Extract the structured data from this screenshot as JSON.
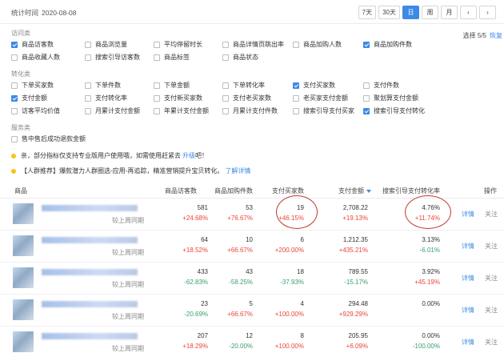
{
  "header": {
    "stat_label": "统计时间",
    "stat_date": "2020-08-08",
    "ranges": [
      "7天",
      "30天",
      "日",
      "周",
      "月"
    ],
    "active_range": "日",
    "prev_icon": "chevron-left-icon",
    "next_icon": "chevron-right-icon"
  },
  "selector": {
    "count_label": "选择 5/5",
    "reset_label": "恢复",
    "categories": {
      "visit": {
        "label": "访问类",
        "options": [
          {
            "label": "商品访客数",
            "checked": true
          },
          {
            "label": "商品浏览量",
            "checked": false
          },
          {
            "label": "平均停留时长",
            "checked": false
          },
          {
            "label": "商品详情页跳出率",
            "checked": false
          },
          {
            "label": "商品加购人数",
            "checked": false
          },
          {
            "label": "商品加购件数",
            "checked": true
          },
          {
            "label": "商品收藏人数",
            "checked": false
          },
          {
            "label": "搜索引导访客数",
            "checked": false
          },
          {
            "label": "商品标签",
            "checked": false
          },
          {
            "label": "商品状态",
            "checked": false
          }
        ]
      },
      "conversion": {
        "label": "转化类",
        "options": [
          {
            "label": "下单买家数",
            "checked": false
          },
          {
            "label": "下单件数",
            "checked": false
          },
          {
            "label": "下单金额",
            "checked": false
          },
          {
            "label": "下单转化率",
            "checked": false
          },
          {
            "label": "支付买家数",
            "checked": true
          },
          {
            "label": "支付件数",
            "checked": false
          },
          {
            "label": "支付金额",
            "checked": true
          },
          {
            "label": "支付转化率",
            "checked": false
          },
          {
            "label": "支付新买家数",
            "checked": false
          },
          {
            "label": "支付老买家数",
            "checked": false
          },
          {
            "label": "老买家支付金额",
            "checked": false
          },
          {
            "label": "聚划算支付金额",
            "checked": false
          },
          {
            "label": "访客平均价值",
            "checked": false
          },
          {
            "label": "月累计支付金额",
            "checked": false
          },
          {
            "label": "年累计支付金额",
            "checked": false
          },
          {
            "label": "月累计支付件数",
            "checked": false
          },
          {
            "label": "搜索引导支付买家",
            "checked": false
          },
          {
            "label": "搜索引导支付转化",
            "checked": true
          }
        ]
      },
      "service": {
        "label": "服务类",
        "options": [
          {
            "label": "售中售后成功退款金额",
            "checked": false
          }
        ]
      }
    }
  },
  "notices": [
    {
      "text": "亲，部分指标仅支持专业版用户使用哦，如需使用赶紧去",
      "link": "升级",
      "suffix": "吧！"
    },
    {
      "text": "【人群推荐】爆款潜力人群圈选-应用-再追踪，精准营销提升宝贝转化。",
      "link": "了解详情",
      "suffix": ""
    }
  ],
  "table": {
    "columns": {
      "product": "商品",
      "visitors": "商品访客数",
      "addcart": "商品加购件数",
      "buyers": "支付买家数",
      "amount": "支付金额",
      "search_conv": "搜索引导支付转化率",
      "actions": "操作"
    },
    "compare_label": "较上周同期",
    "detail_label": "详情",
    "follow_label": "关注",
    "rows": [
      {
        "visitors": "581",
        "visitors_chg": "+24.68%",
        "visitors_dir": "up",
        "addcart": "53",
        "addcart_chg": "+76.67%",
        "addcart_dir": "up",
        "buyers": "19",
        "buyers_chg": "+46.15%",
        "buyers_dir": "up",
        "amount": "2,708.22",
        "amount_chg": "+19.13%",
        "amount_dir": "up",
        "conv": "4.76%",
        "conv_chg": "+11.74%",
        "conv_dir": "up"
      },
      {
        "visitors": "64",
        "visitors_chg": "+18.52%",
        "visitors_dir": "up",
        "addcart": "10",
        "addcart_chg": "+66.67%",
        "addcart_dir": "up",
        "buyers": "6",
        "buyers_chg": "+200.00%",
        "buyers_dir": "up",
        "amount": "1,212.35",
        "amount_chg": "+435.21%",
        "amount_dir": "up",
        "conv": "3.13%",
        "conv_chg": "-6.01%",
        "conv_dir": "down"
      },
      {
        "visitors": "433",
        "visitors_chg": "-62.83%",
        "visitors_dir": "down",
        "addcart": "43",
        "addcart_chg": "-58.25%",
        "addcart_dir": "down",
        "buyers": "18",
        "buyers_chg": "-37.93%",
        "buyers_dir": "down",
        "amount": "789.55",
        "amount_chg": "-15.17%",
        "amount_dir": "down",
        "conv": "3.92%",
        "conv_chg": "+45.19%",
        "conv_dir": "up"
      },
      {
        "visitors": "23",
        "visitors_chg": "-20.69%",
        "visitors_dir": "down",
        "addcart": "5",
        "addcart_chg": "+66.67%",
        "addcart_dir": "up",
        "buyers": "4",
        "buyers_chg": "+100.00%",
        "buyers_dir": "up",
        "amount": "294.48",
        "amount_chg": "+929.29%",
        "amount_dir": "up",
        "conv": "0.00%",
        "conv_chg": "",
        "conv_dir": "neutral"
      },
      {
        "visitors": "207",
        "visitors_chg": "+18.29%",
        "visitors_dir": "up",
        "addcart": "12",
        "addcart_chg": "-20.00%",
        "addcart_dir": "down",
        "buyers": "8",
        "buyers_chg": "+100.00%",
        "buyers_dir": "up",
        "amount": "205.95",
        "amount_chg": "+6.09%",
        "amount_dir": "up",
        "conv": "0.00%",
        "conv_chg": "-100.00%",
        "conv_dir": "down"
      }
    ]
  },
  "colors": {
    "accent": "#3b8ae6",
    "up": "#e8463c",
    "down": "#3aa06b",
    "annotation": "#c0392b",
    "notice_dot": "#f5c518"
  }
}
